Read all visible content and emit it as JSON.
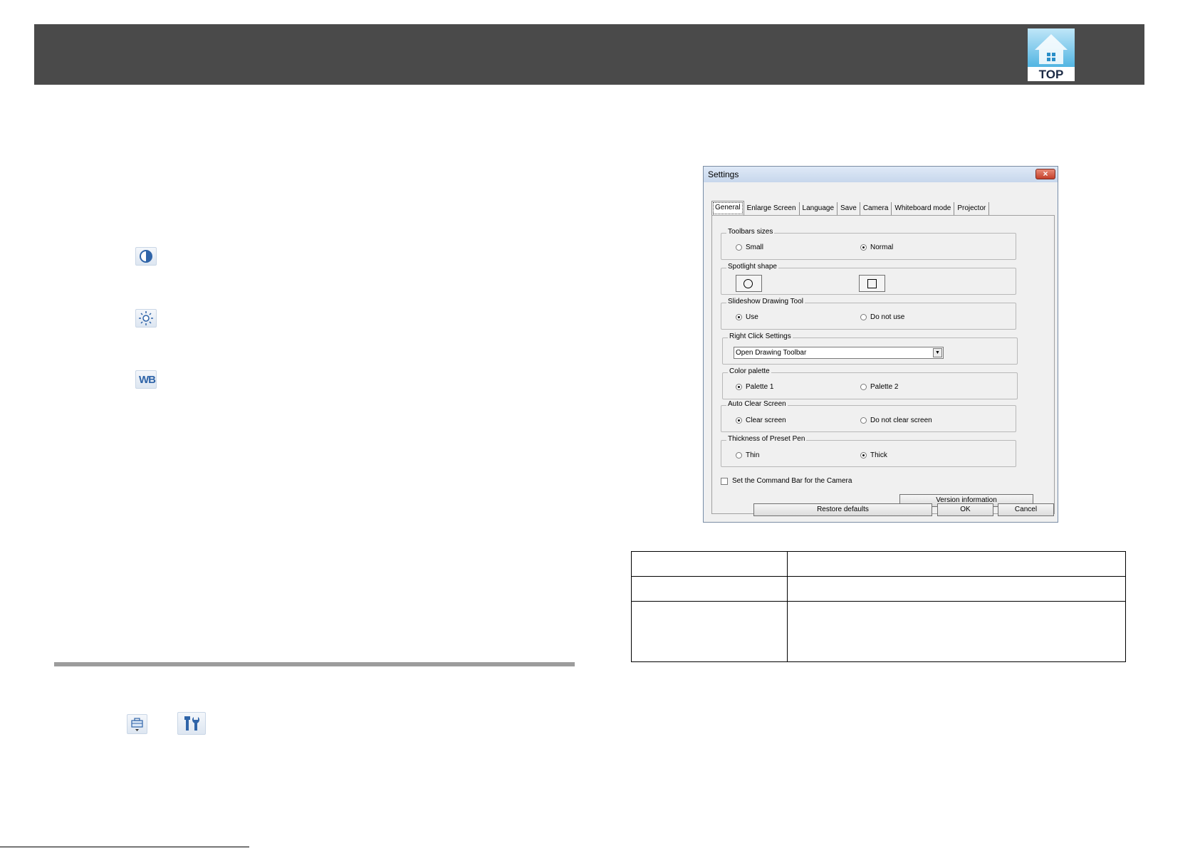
{
  "header": {
    "logo_text": "TOP"
  },
  "side_icons": [
    "contrast-icon",
    "brightness-icon",
    "white-balance-icon"
  ],
  "side_icon_labels": {
    "white_balance": "WB"
  },
  "bottom_icons": [
    "toolbox-icon",
    "settings-tools-icon"
  ],
  "dialog": {
    "title": "Settings",
    "close_label": "×",
    "tabs": [
      "General",
      "Enlarge Screen",
      "Language",
      "Save",
      "Camera",
      "Whiteboard mode",
      "Projector"
    ],
    "active_tab": "General",
    "groups": {
      "toolbar_sizes": {
        "legend": "Toolbars sizes",
        "options": [
          "Small",
          "Normal"
        ],
        "selected": "Normal"
      },
      "spotlight_shape": {
        "legend": "Spotlight shape",
        "options": [
          "circle",
          "square"
        ],
        "selected": "circle"
      },
      "slideshow_tool": {
        "legend": "Slideshow Drawing Tool",
        "options": [
          "Use",
          "Do not use"
        ],
        "selected": "Use"
      },
      "right_click": {
        "legend": "Right Click Settings",
        "value": "Open Drawing Toolbar"
      },
      "color_palette": {
        "legend": "Color palette",
        "options": [
          "Palette 1",
          "Palette 2"
        ],
        "selected": "Palette 1"
      },
      "auto_clear": {
        "legend": "Auto Clear Screen",
        "options": [
          "Clear screen",
          "Do not clear screen"
        ],
        "selected": "Clear screen"
      },
      "pen_thickness": {
        "legend": "Thickness of Preset Pen",
        "options": [
          "Thin",
          "Thick"
        ],
        "selected": "Thick"
      }
    },
    "command_bar_checkbox": {
      "label": "Set the Command Bar for the Camera",
      "checked": false
    },
    "buttons": {
      "version": "Version information",
      "restore": "Restore defaults",
      "ok": "OK",
      "cancel": "Cancel"
    }
  },
  "table": {
    "rows": [
      [
        "",
        ""
      ],
      [
        "",
        ""
      ],
      [
        "",
        ""
      ]
    ]
  }
}
